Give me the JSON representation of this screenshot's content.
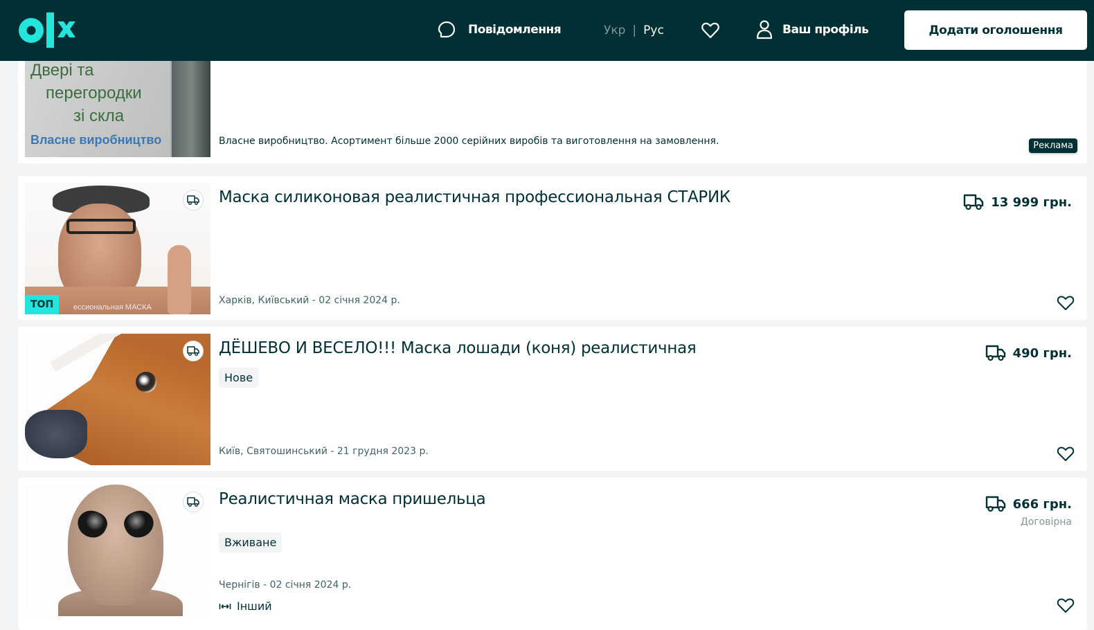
{
  "header": {
    "messages_label": "Повідомлення",
    "lang_ukr": "Укр",
    "lang_sep": "|",
    "lang_rus": "Рус",
    "profile_label": "Ваш профіль",
    "add_button": "Додати оголошення",
    "brand_color": "#002f34",
    "accent_color": "#23e5db"
  },
  "ad": {
    "image_lines": [
      "Двері та",
      "перегородки",
      "зі скла"
    ],
    "image_subtitle": "Власне виробництво",
    "description": "Власне виробництво. Асортимент більше 2000 серійних виробів та виготовлення на замовлення.",
    "badge": "Реклама"
  },
  "listings": [
    {
      "title": "Маска силиконовая реалистичная профессиональная СТАРИК",
      "price": "13 999 грн.",
      "location_date": "Харків, Київський - 02 січня 2024 р.",
      "badge": "ТОП",
      "image_caption": "ессиональная МАСКА",
      "delivery": true
    },
    {
      "title": "ДЁШЕВО И ВЕСЕЛО!!! Маска лошади (коня) реалистичная",
      "price": "490 грн.",
      "condition": "Нове",
      "location_date": "Київ, Святошинський - 21 грудня 2023 р.",
      "delivery": true
    },
    {
      "title": "Реалистичная маска пришельца",
      "price": "666 грн.",
      "negotiable": "Договірна",
      "condition": "Вживане",
      "location_date": "Чернігів - 02 січня 2024 р.",
      "size_label": "Інший",
      "delivery": true
    }
  ]
}
